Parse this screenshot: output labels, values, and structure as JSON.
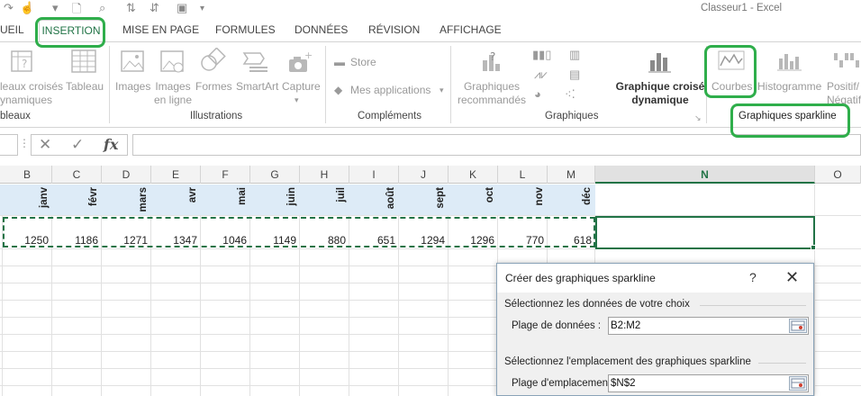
{
  "window": {
    "title": "Classeur1 - Excel"
  },
  "tabs": [
    {
      "label": "UEIL",
      "active": false
    },
    {
      "label": "INSERTION",
      "active": true
    },
    {
      "label": "MISE EN PAGE",
      "active": false
    },
    {
      "label": "FORMULES",
      "active": false
    },
    {
      "label": "DONNÉES",
      "active": false
    },
    {
      "label": "RÉVISION",
      "active": false
    },
    {
      "label": "AFFICHAGE",
      "active": false
    }
  ],
  "ribbon": {
    "tables": {
      "pivot_line1": "leaux croisés",
      "pivot_line2": "ynamiques",
      "table": "Tableau",
      "group_label": "bleaux"
    },
    "illustrations": {
      "images": "Images",
      "online_line1": "Images",
      "online_line2": "en ligne",
      "shapes": "Formes",
      "smartart": "SmartArt",
      "capture": "Capture",
      "group_label": "Illustrations"
    },
    "addins": {
      "store": "Store",
      "my_apps": "Mes applications",
      "group_label": "Compléments"
    },
    "charts": {
      "recommended_line1": "Graphiques",
      "recommended_line2": "recommandés",
      "pivot_chart_line1": "Graphique croisé",
      "pivot_chart_line2": "dynamique",
      "group_label": "Graphiques"
    },
    "sparklines": {
      "lines": "Courbes",
      "histogram": "Histogramme",
      "winloss_line1": "Positif/",
      "winloss_line2": "Négatif",
      "group_label": "Graphiques sparkline"
    }
  },
  "formula_bar": {
    "fx": "fx",
    "value": ""
  },
  "columns": [
    "B",
    "C",
    "D",
    "E",
    "F",
    "G",
    "H",
    "I",
    "J",
    "K",
    "L",
    "M",
    "N",
    "O"
  ],
  "selected_column": "N",
  "months": [
    "janv",
    "févr",
    "mars",
    "avr",
    "mai",
    "juin",
    "juil",
    "août",
    "sept",
    "oct",
    "nov",
    "déc"
  ],
  "values": [
    1250,
    1186,
    1271,
    1347,
    1046,
    1149,
    880,
    651,
    1294,
    1296,
    770,
    618
  ],
  "dialog": {
    "title": "Créer des graphiques sparkline",
    "help": "?",
    "close": "✕",
    "section_data": "Sélectionnez les données de votre choix",
    "data_range_label": "Plage de données :",
    "data_range_value": "B2:M2",
    "section_location": "Sélectionnez l'emplacement des graphiques sparkline",
    "location_range_label": "Plage d'emplacements :",
    "location_range_value": "$N$2"
  },
  "colors": {
    "accent": "#217346",
    "highlight": "#2fae4b",
    "header_fill": "#ddebf7"
  }
}
